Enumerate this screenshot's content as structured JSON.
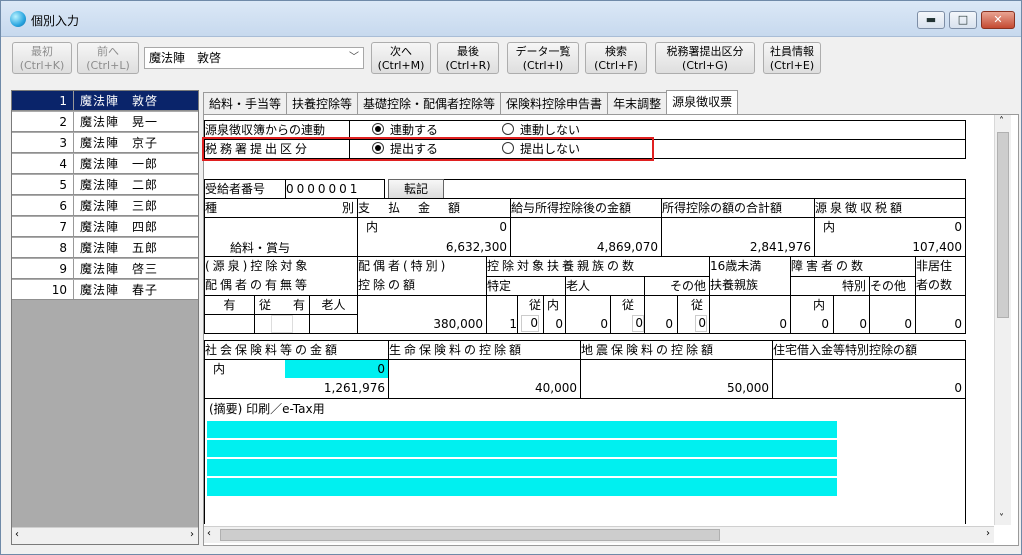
{
  "window": {
    "title": "個別入力",
    "btn_min": "▬",
    "btn_max": "□",
    "btn_close": "✕"
  },
  "toolbar": {
    "first": "最初\n(Ctrl+K)",
    "prev": "前へ\n(Ctrl+L)",
    "employee_select": "魔法陣　敦啓",
    "next": "次へ\n(Ctrl+M)",
    "last": "最後\n(Ctrl+R)",
    "data_list": "データ一覧\n(Ctrl+I)",
    "search": "検索\n(Ctrl+F)",
    "tax_office": "税務署提出区分\n(Ctrl+G)",
    "emp_info": "社員情報\n(Ctrl+E)"
  },
  "employees": [
    {
      "no": "1",
      "name": "魔法陣　敦啓"
    },
    {
      "no": "2",
      "name": "魔法陣　晃一"
    },
    {
      "no": "3",
      "name": "魔法陣　京子"
    },
    {
      "no": "4",
      "name": "魔法陣　一郎"
    },
    {
      "no": "5",
      "name": "魔法陣　二郎"
    },
    {
      "no": "6",
      "name": "魔法陣　三郎"
    },
    {
      "no": "7",
      "name": "魔法陣　四郎"
    },
    {
      "no": "8",
      "name": "魔法陣　五郎"
    },
    {
      "no": "9",
      "name": "魔法陣　啓三"
    },
    {
      "no": "10",
      "name": "魔法陣　春子"
    }
  ],
  "tabs": [
    "給料・手当等",
    "扶養控除等",
    "基礎控除・配偶者控除等",
    "保険料控除申告書",
    "年末調整",
    "源泉徴収票"
  ],
  "form": {
    "link_label": "源泉徴収簿からの連動",
    "link_yes": "連動する",
    "link_no": "連動しない",
    "submit_label": "税務署提出区分",
    "submit_yes": "提出する",
    "submit_no": "提出しない",
    "recipient_no_label": "受給者番号",
    "recipient_no": "0000001",
    "tenki": "転記",
    "h_type": "種",
    "h_type2": "別",
    "h_pay": "支　払　金　額",
    "h_after": "給与所得控除後の金額",
    "h_total_ded": "所得控除の額の合計額",
    "h_tax": "源泉徴収税額",
    "uchi": "内",
    "pay_inner": "0",
    "type_value": "給料・賞与",
    "pay": "6,632,300",
    "after": "4,869,070",
    "total_ded": "2,841,976",
    "tax_inner": "0",
    "tax": "107,400",
    "h_spouse_obj": "(源泉)控除対象",
    "h_spouse_has": "配偶者の有無等",
    "h_spouse_ded": "配偶者(特別)",
    "h_spouse_ded2": "控除の額",
    "h_dep": "控除対象扶養親族の数",
    "h_under16": "16歳未満",
    "h_under16b": "扶養親族",
    "h_dis": "障害者の数",
    "h_nonres": "非居住",
    "h_nonres2": "者の数",
    "h_yes": "有",
    "h_ju": "従",
    "h_yes2": "有",
    "h_old": "老人",
    "h_tokutei": "特定",
    "h_rojin": "老人",
    "h_other": "その他",
    "h_tokubetsu": "特別",
    "h_other2": "その他",
    "spouse_ded": "380,000",
    "tok_1": "1",
    "tok_ju": "0",
    "tok_2": "0",
    "ro_1": "0",
    "ro_ju": "0",
    "ro_2": "0",
    "oth_1": "0",
    "oth_ju": "0",
    "u16": "0",
    "dis_1": "0",
    "dis_2": "0",
    "dis_oth": "0",
    "nonres": "0",
    "h_social": "社会保険料等の金額",
    "h_life": "生命保険料の控除額",
    "h_quake": "地震保険料の控除額",
    "h_housing": "住宅借入金等特別控除の額",
    "social_inner": "0",
    "social": "1,261,976",
    "life": "40,000",
    "quake": "50,000",
    "housing": "0",
    "memo_label": "(摘要) 印刷／e-Tax用"
  }
}
